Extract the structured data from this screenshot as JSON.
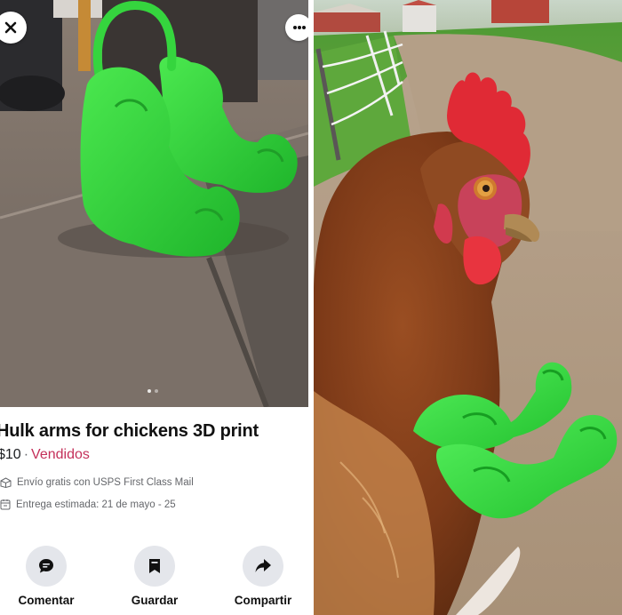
{
  "listing": {
    "title": "Hulk arms for chickens 3D print",
    "price": "$10",
    "separator": "·",
    "status": "Vendidos",
    "shipping": "Envío gratis con USPS First Class Mail",
    "delivery": "Entrega estimada: 21 de mayo - 25"
  },
  "actions": {
    "comment": "Comentar",
    "save": "Guardar",
    "share": "Compartir"
  },
  "icons": {
    "close": "close-icon",
    "more": "more-horizontal-icon",
    "shipping": "shipping-icon",
    "delivery": "calendar-icon",
    "comment": "comment-bubble-icon",
    "save": "bookmark-icon",
    "share": "share-arrow-icon"
  },
  "photo_carousel": {
    "pages": 2,
    "current": 1
  },
  "colors": {
    "status_sold": "#c4305a",
    "action_circle": "#e4e6eb",
    "hulk_green": "#2fd43a"
  }
}
